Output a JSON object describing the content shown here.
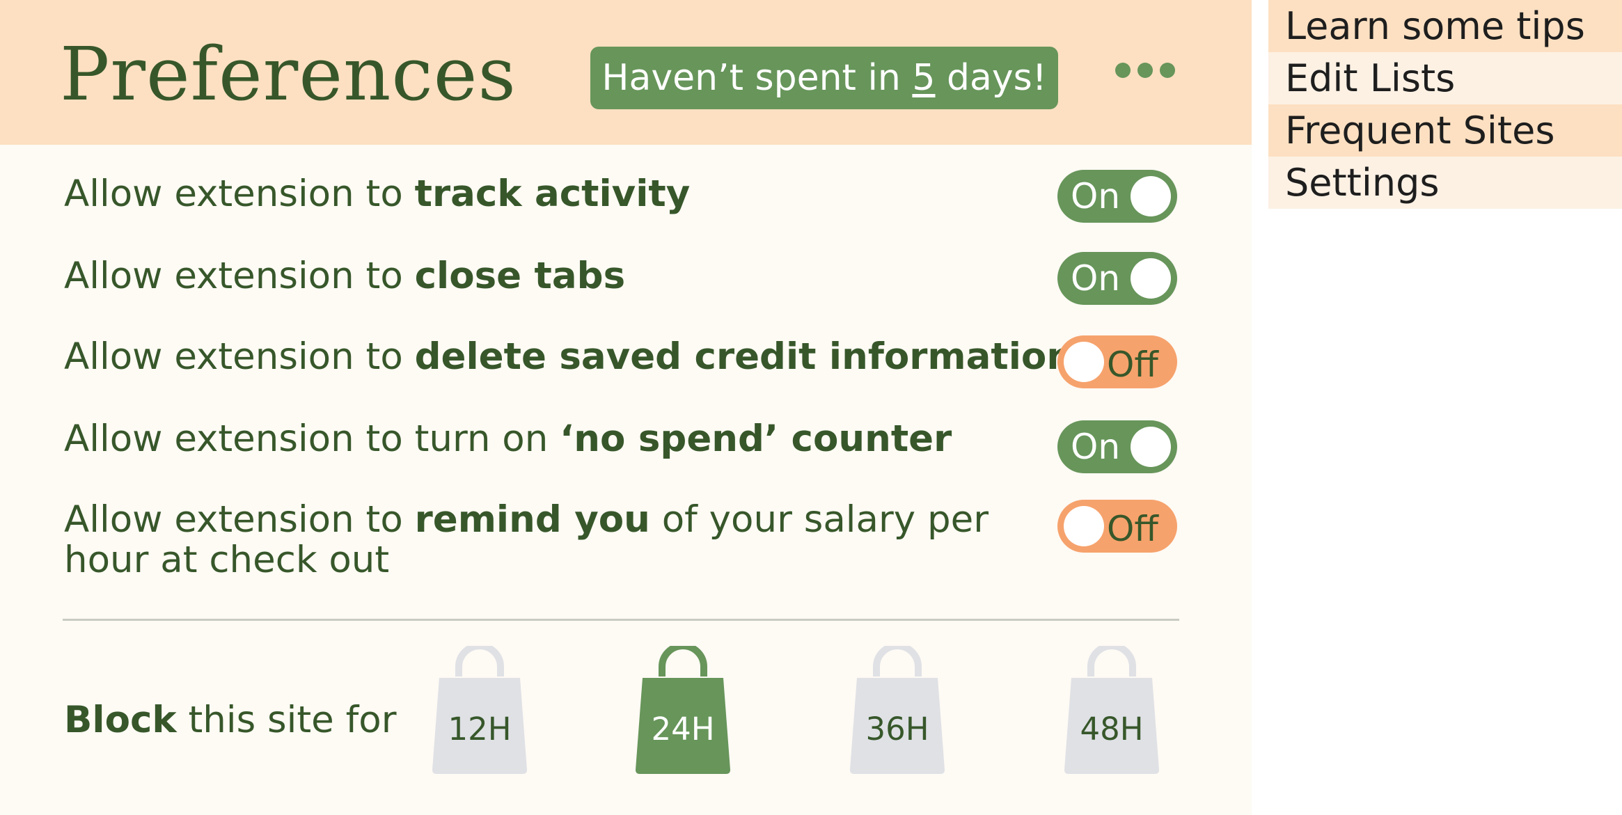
{
  "header": {
    "title": "Preferences",
    "streak": {
      "prefix": "Haven’t spent in ",
      "number": "5",
      "suffix": " days!"
    },
    "more_icon": "more-dots-icon"
  },
  "preferences": [
    {
      "prefix": "Allow extension to ",
      "bold": "track activity",
      "suffix": "",
      "suffix_line2": "",
      "state": "On"
    },
    {
      "prefix": "Allow extension to ",
      "bold": "close tabs",
      "suffix": "",
      "suffix_line2": "",
      "state": "On"
    },
    {
      "prefix": "Allow extension to ",
      "bold": "delete saved credit information",
      "suffix": "",
      "suffix_line2": "",
      "state": "Off"
    },
    {
      "prefix": "Allow extension to turn on ",
      "bold": "‘no spend’ counter",
      "suffix": "",
      "suffix_line2": "",
      "state": "On"
    },
    {
      "prefix": "Allow extension to ",
      "bold": "remind you",
      "suffix": " of your salary per",
      "suffix_line2": "hour at check out",
      "state": "Off"
    }
  ],
  "block": {
    "bold": "Block",
    "rest": " this site for",
    "options": [
      {
        "label": "12H",
        "selected": false
      },
      {
        "label": "24H",
        "selected": true
      },
      {
        "label": "36H",
        "selected": false
      },
      {
        "label": "48H",
        "selected": false
      }
    ],
    "icon": "shopping-bag-icon"
  },
  "menu": {
    "items": [
      "Learn some tips",
      "Edit Lists",
      "Frequent Sites",
      "Settings"
    ]
  },
  "colors": {
    "header_bg": "#fde0c2",
    "panel_bg": "#fefaf4",
    "green": "#67955a",
    "dark_green": "#37572a",
    "orange": "#f6a26c",
    "bag_inactive": "#dfe1e5",
    "menu_alt": "#fdf1e4"
  }
}
